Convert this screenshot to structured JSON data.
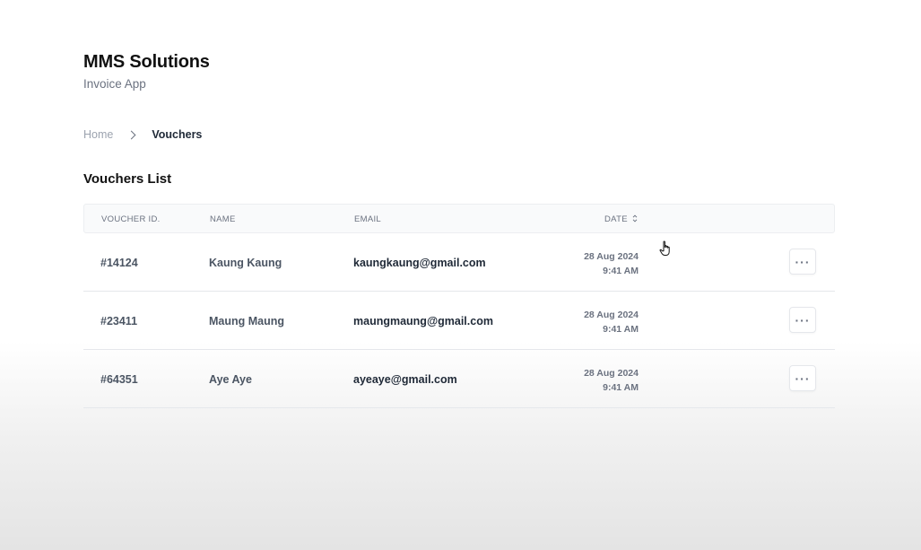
{
  "header": {
    "title": "MMS Solutions",
    "subtitle": "Invoice App"
  },
  "breadcrumb": {
    "home": "Home",
    "current": "Vouchers",
    "separator_icon": "chevron-right-icon"
  },
  "section": {
    "title": "Vouchers List"
  },
  "table": {
    "columns": {
      "voucher_id": "VOUCHER ID.",
      "name": "NAME",
      "email": "EMAIL",
      "date": "DATE"
    },
    "sort_icon": "sort-icon",
    "rows": [
      {
        "id": "#14124",
        "name": "Kaung Kaung",
        "email": "kaungkaung@gmail.com",
        "date": "28 Aug 2024",
        "time": "9:41 AM",
        "action_icon": "more-horizontal-icon"
      },
      {
        "id": "#23411",
        "name": "Maung Maung",
        "email": "maungmaung@gmail.com",
        "date": "28 Aug 2024",
        "time": "9:41 AM",
        "action_icon": "more-horizontal-icon"
      },
      {
        "id": "#64351",
        "name": "Aye Aye",
        "email": "ayeaye@gmail.com",
        "date": "28 Aug 2024",
        "time": "9:41 AM",
        "action_icon": "more-horizontal-icon"
      }
    ]
  }
}
